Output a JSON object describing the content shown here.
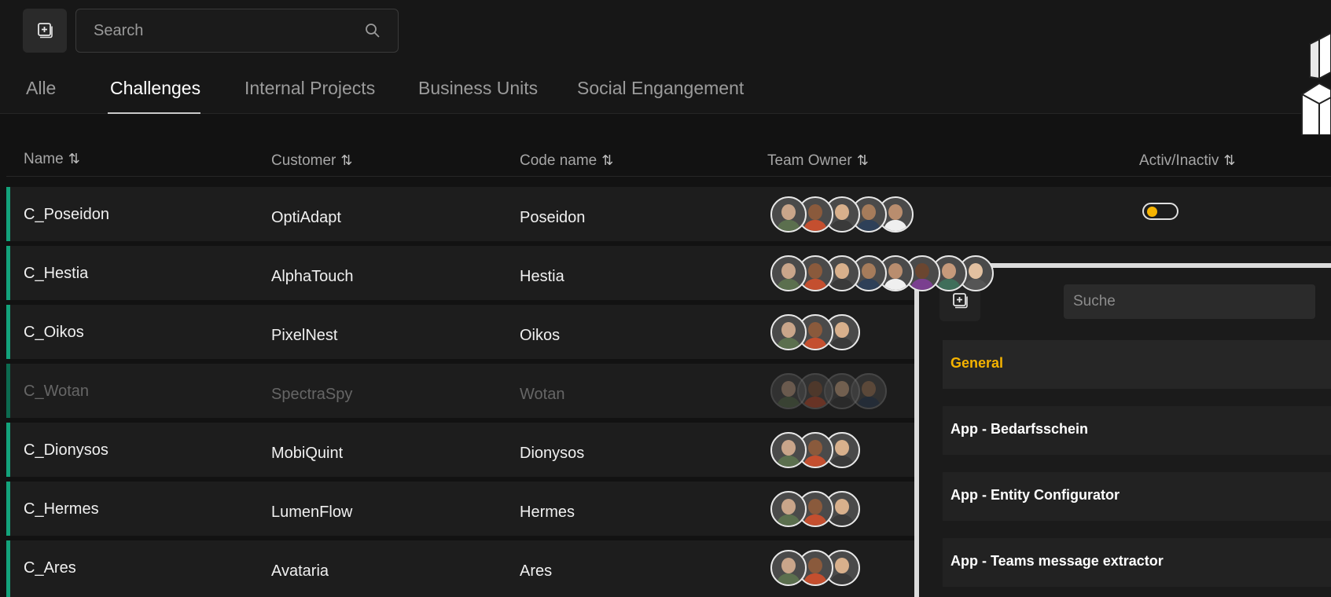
{
  "toolbar": {
    "search_placeholder": "Search"
  },
  "tabs": [
    {
      "label": "Alle",
      "active": false
    },
    {
      "label": "Challenges",
      "active": true
    },
    {
      "label": "Internal Projects",
      "active": false
    },
    {
      "label": "Business Units",
      "active": false
    },
    {
      "label": "Social Engangement",
      "active": false
    }
  ],
  "table": {
    "columns": [
      {
        "label": "Name",
        "sort_icon": "sort-arrows-icon"
      },
      {
        "label": "Customer",
        "sort_icon": "sort-arrows-icon"
      },
      {
        "label": "Code name",
        "sort_icon": "sort-arrows-icon"
      },
      {
        "label": "Team Owner",
        "sort_icon": "sort-arrows-icon"
      },
      {
        "label": "Activ/Inactiv",
        "sort_icon": "sort-arrows-icon"
      }
    ],
    "rows": [
      {
        "name": "C_Poseidon",
        "customer": "OptiAdapt",
        "code_name": "Poseidon",
        "avatar_count": 5,
        "inactive": false,
        "toggle": true
      },
      {
        "name": "C_Hestia",
        "customer": "AlphaTouch",
        "code_name": "Hestia",
        "avatar_count": 8,
        "inactive": false,
        "toggle": false
      },
      {
        "name": "C_Oikos",
        "customer": "PixelNest",
        "code_name": "Oikos",
        "avatar_count": 3,
        "inactive": false,
        "toggle": false
      },
      {
        "name": "C_Wotan",
        "customer": "SpectraSpy",
        "code_name": "Wotan",
        "avatar_count": 4,
        "inactive": true,
        "toggle": false
      },
      {
        "name": "C_Dionysos",
        "customer": "MobiQuint",
        "code_name": "Dionysos",
        "avatar_count": 3,
        "inactive": false,
        "toggle": false
      },
      {
        "name": "C_Hermes",
        "customer": "LumenFlow",
        "code_name": "Hermes",
        "avatar_count": 3,
        "inactive": false,
        "toggle": false
      },
      {
        "name": "C_Ares",
        "customer": "Avataria",
        "code_name": "Ares",
        "avatar_count": 3,
        "inactive": false,
        "toggle": false
      }
    ]
  },
  "panel": {
    "search_placeholder": "Suche",
    "items": [
      {
        "label": "General",
        "active": true
      },
      {
        "label": "App - Bedarfsschein",
        "active": false
      },
      {
        "label": "App - Entity Configurator",
        "active": false
      },
      {
        "label": "App - Teams message extractor",
        "active": false
      }
    ]
  },
  "colors": {
    "accent_green": "#13a37b",
    "toggle_knob": "#f5b300",
    "active_item": "#f5b300"
  }
}
